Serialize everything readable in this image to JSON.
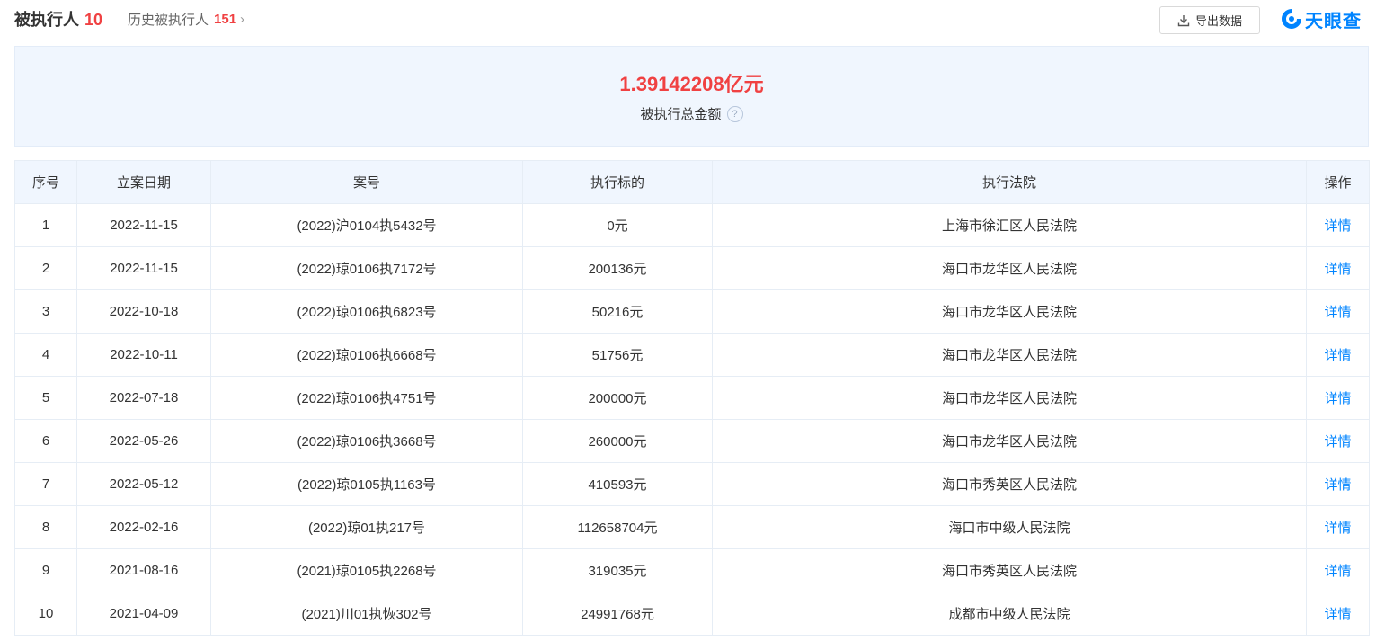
{
  "header": {
    "title": "被执行人",
    "count": "10",
    "history_label": "历史被执行人",
    "history_count": "151",
    "export_label": "导出数据",
    "logo_text": "天眼查"
  },
  "summary": {
    "amount": "1.39142208亿元",
    "label": "被执行总金额",
    "help": "?"
  },
  "table": {
    "headers": [
      "序号",
      "立案日期",
      "案号",
      "执行标的",
      "执行法院",
      "操作"
    ],
    "rows": [
      [
        "1",
        "2022-11-15",
        "(2022)沪0104执5432号",
        "0元",
        "上海市徐汇区人民法院",
        "详情"
      ],
      [
        "2",
        "2022-11-15",
        "(2022)琼0106执7172号",
        "200136元",
        "海口市龙华区人民法院",
        "详情"
      ],
      [
        "3",
        "2022-10-18",
        "(2022)琼0106执6823号",
        "50216元",
        "海口市龙华区人民法院",
        "详情"
      ],
      [
        "4",
        "2022-10-11",
        "(2022)琼0106执6668号",
        "51756元",
        "海口市龙华区人民法院",
        "详情"
      ],
      [
        "5",
        "2022-07-18",
        "(2022)琼0106执4751号",
        "200000元",
        "海口市龙华区人民法院",
        "详情"
      ],
      [
        "6",
        "2022-05-26",
        "(2022)琼0106执3668号",
        "260000元",
        "海口市龙华区人民法院",
        "详情"
      ],
      [
        "7",
        "2022-05-12",
        "(2022)琼0105执1163号",
        "410593元",
        "海口市秀英区人民法院",
        "详情"
      ],
      [
        "8",
        "2022-02-16",
        "(2022)琼01执217号",
        "112658704元",
        "海口市中级人民法院",
        "详情"
      ],
      [
        "9",
        "2021-08-16",
        "(2021)琼0105执2268号",
        "319035元",
        "海口市秀英区人民法院",
        "详情"
      ],
      [
        "10",
        "2021-04-09",
        "(2021)川01执恢302号",
        "24991768元",
        "成都市中级人民法院",
        "详情"
      ]
    ]
  },
  "colors": {
    "accent": "#0084ff",
    "highlight": "#f04142",
    "summary_bg": "#f0f6fe"
  }
}
